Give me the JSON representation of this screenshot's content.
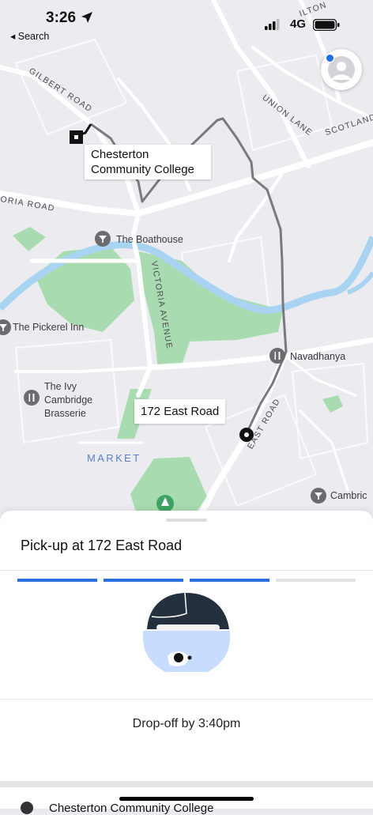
{
  "status_bar": {
    "time": "3:26",
    "back_label": "◂ Search",
    "network": "4G"
  },
  "map": {
    "destination_label": "Chesterton Community College",
    "pickup_label": "172 East Road",
    "places": {
      "boathouse": "The Boathouse",
      "pickerel": "The Pickerel Inn",
      "navadhanya": "Navadhanya",
      "ivy": "The Ivy Cambridge Brasserie",
      "cambridge": "Cambric",
      "market": "MARKET"
    },
    "roads": {
      "gilbert": "GILBERT ROAD",
      "union": "UNION LANE",
      "scotland": "SCOTLAND",
      "victoria_road": "ORIA ROAD",
      "victoria_ave": "VICTORIA AVENUE",
      "east": "EAST ROAD",
      "milton": "ILTON"
    }
  },
  "sheet": {
    "pickup_title": "Pick-up at 172 East Road",
    "dropoff_text": "Drop-off by 3:40pm",
    "progress": [
      1,
      1,
      1,
      0
    ],
    "destination": "Chesterton Community College"
  },
  "colors": {
    "accent": "#2a6ee0",
    "park": "#a8dcb0",
    "river": "#a8d4f2",
    "route": "#7a7a7e"
  }
}
